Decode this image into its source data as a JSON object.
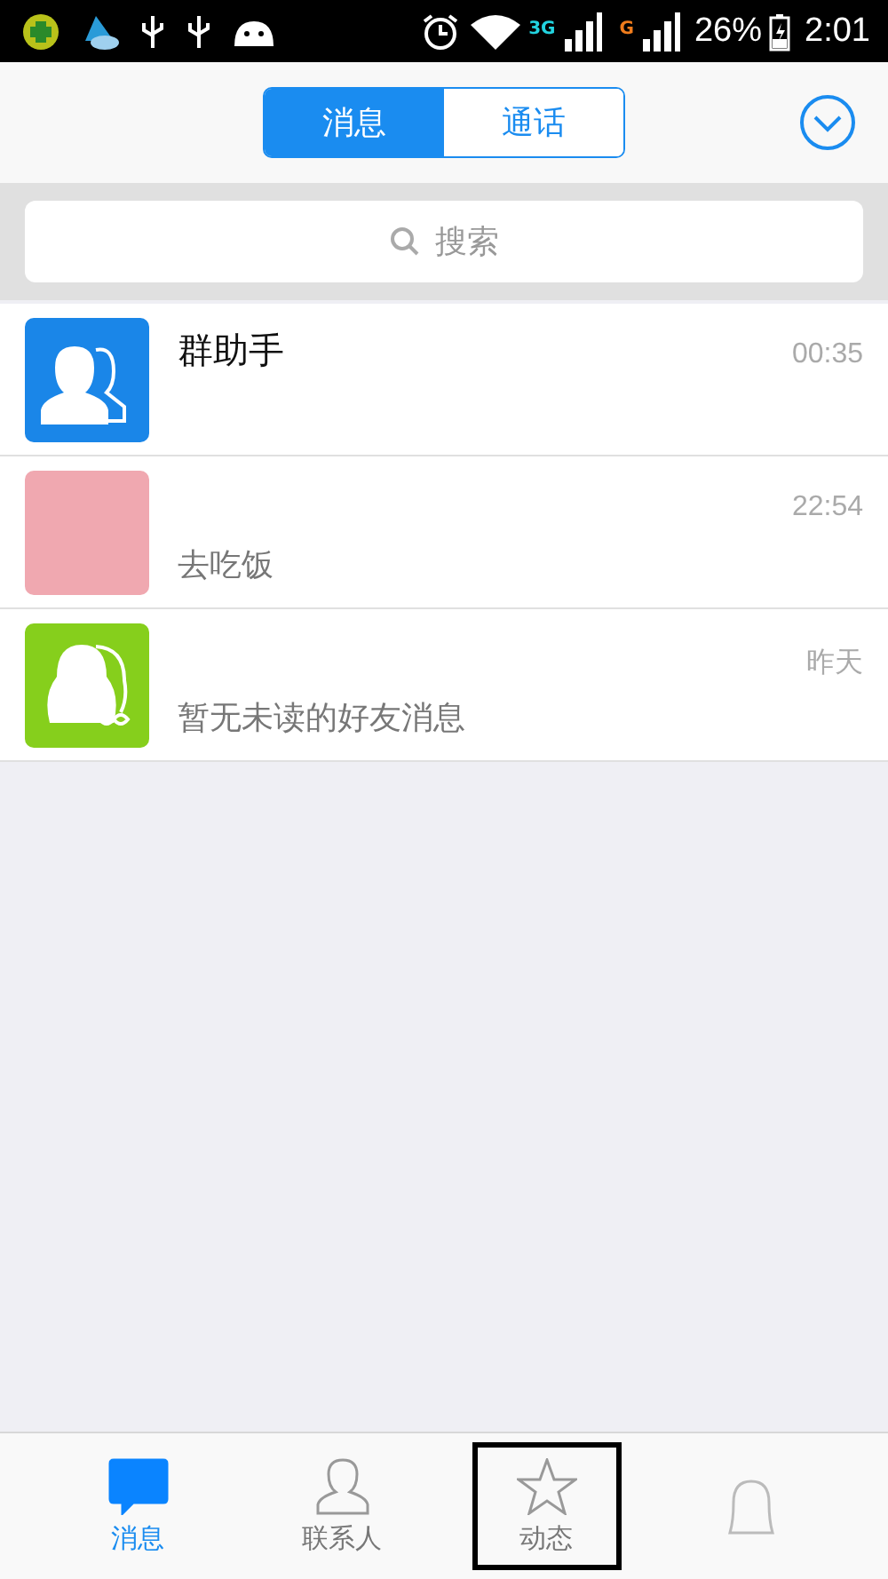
{
  "status_bar": {
    "network_1": "3G",
    "network_2": "G",
    "battery": "26%",
    "time": "2:01"
  },
  "header": {
    "segments": [
      {
        "label": "消息",
        "selected": true
      },
      {
        "label": "通话",
        "selected": false
      }
    ]
  },
  "search": {
    "placeholder": "搜索"
  },
  "conversations": [
    {
      "kind": "group",
      "name": "群助手",
      "time": "00:35"
    },
    {
      "kind": "photo",
      "preview": "去吃饭",
      "time": "22:54"
    },
    {
      "kind": "friend",
      "preview": "暂无未读的好友消息",
      "time": "昨天"
    }
  ],
  "tab_bar": [
    {
      "kind": "chat",
      "label": "消息",
      "selected": true,
      "highlighted": false
    },
    {
      "kind": "contact",
      "label": "联系人",
      "selected": false,
      "highlighted": false
    },
    {
      "kind": "star",
      "label": "动态",
      "selected": false,
      "highlighted": true
    },
    {
      "kind": "bell",
      "selected": false,
      "highlighted": false
    }
  ]
}
